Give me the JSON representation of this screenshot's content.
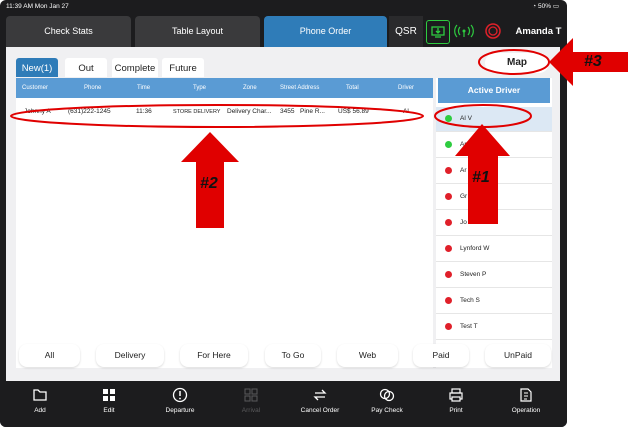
{
  "status_bar": {
    "time": "11:39 AM Mon Jan 27",
    "battery": "50%"
  },
  "top_nav": {
    "tabs": [
      {
        "label": "Check Stats"
      },
      {
        "label": "Table Layout"
      },
      {
        "label": "Phone Order"
      }
    ],
    "qsr_label": "QSR",
    "user_name": "Amanda T"
  },
  "order_tabs": [
    {
      "label": "New(1)"
    },
    {
      "label": "Out"
    },
    {
      "label": "Complete"
    },
    {
      "label": "Future"
    }
  ],
  "map_button": "Map",
  "table": {
    "headers": [
      "Customer",
      "Phone",
      "Time",
      "Type",
      "Zone",
      "Street Address",
      "Total",
      "Driver"
    ],
    "rows": [
      {
        "customer": "Johnny A",
        "phone": "(631)222-1245",
        "time": "11:36",
        "type": "STORE DELIVERY",
        "zone": "Delivery Char...",
        "street": "3455",
        "street2": "Pine R...",
        "total": "US$ 56.89",
        "driver": "Al"
      }
    ]
  },
  "active_driver": {
    "title": "Active Driver",
    "drivers": [
      {
        "name": "Al V",
        "status": "green"
      },
      {
        "name": "Am...T",
        "status": "green"
      },
      {
        "name": "Ar",
        "status": "red"
      },
      {
        "name": "Gr",
        "status": "red"
      },
      {
        "name": "Jo",
        "status": "red"
      },
      {
        "name": "Lynford W",
        "status": "red"
      },
      {
        "name": "Steven P",
        "status": "red"
      },
      {
        "name": "Tech S",
        "status": "red"
      },
      {
        "name": "Test T",
        "status": "red"
      }
    ]
  },
  "filters": [
    {
      "label": "All"
    },
    {
      "label": "Delivery"
    },
    {
      "label": "For Here"
    },
    {
      "label": "To Go"
    },
    {
      "label": "Web"
    },
    {
      "label": "Paid"
    },
    {
      "label": "UnPaid"
    }
  ],
  "bottom_actions": [
    {
      "label": "Add",
      "icon": "folder-icon"
    },
    {
      "label": "Edit",
      "icon": "edit-grid-icon"
    },
    {
      "label": "Departure",
      "icon": "alert-circle-icon"
    },
    {
      "label": "Arrival",
      "icon": "arrival-grid-icon"
    },
    {
      "label": "Cancel Order",
      "icon": "swap-icon"
    },
    {
      "label": "Pay Check",
      "icon": "coins-icon"
    },
    {
      "label": "Print",
      "icon": "printer-icon"
    },
    {
      "label": "Operation",
      "icon": "operation-icon"
    }
  ],
  "annotations": {
    "a1": "#1",
    "a2": "#2",
    "a3": "#3"
  },
  "colors": {
    "accent": "#2f7cb8",
    "header": "#5a9bd4",
    "online": "#2ecc40",
    "offline": "#e0202a",
    "annotation_red": "#e00000"
  }
}
